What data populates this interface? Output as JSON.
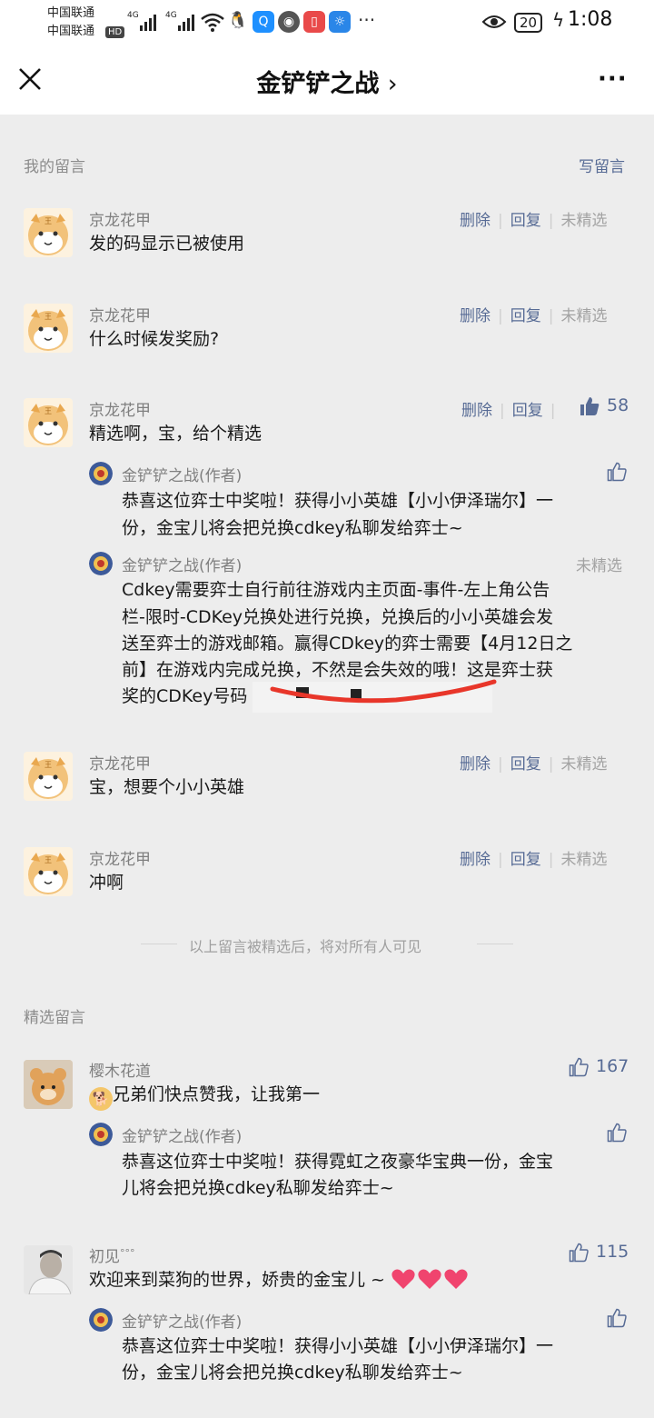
{
  "status_bar": {
    "carrier1": "中国联通",
    "carrier2": "中国联通",
    "hd": "HD",
    "net1": "4G",
    "net2": "4G",
    "battery": "20",
    "time": "1:08"
  },
  "header": {
    "title": "金铲铲之战",
    "title_chevron": "›"
  },
  "my_comments": {
    "label": "我的留言",
    "write_label": "写留言",
    "delete_label": "删除",
    "reply_label": "回复",
    "unselected_label": "未精选",
    "items": [
      {
        "author": "京龙花甲",
        "text": "发的码显示已被使用"
      },
      {
        "author": "京龙花甲",
        "text": "什么时候发奖励?"
      },
      {
        "author": "京龙花甲",
        "text": "精选啊，宝，给个精选",
        "likes": "58",
        "replies": [
          {
            "author": "金铲铲之战(作者)",
            "lines": [
              "恭喜这位弈士中奖啦！获得小小英雄【小小伊泽瑞尔】一",
              "份，金宝儿将会把兑换cdkey私聊发给弈士~"
            ]
          },
          {
            "author": "金铲铲之战(作者)",
            "status": "未精选",
            "lines": [
              "Cdkey需要弈士自行前往游戏内主页面-事件-左上角公告",
              "栏-限时-CDKey兑换处进行兑换，兑换后的小小英雄会发",
              "送至弈士的游戏邮箱。赢得CDkey的弈士需要【4月12日之",
              "前】在游戏内完成兑换，不然是会失效的哦！这是弈士获",
              "奖的CDKey号码"
            ]
          }
        ]
      },
      {
        "author": "京龙花甲",
        "text": "宝，想要个小小英雄"
      },
      {
        "author": "京龙花甲",
        "text": "冲啊"
      }
    ]
  },
  "notice": "以上留言被精选后，将对所有人可见",
  "featured": {
    "label": "精选留言",
    "items": [
      {
        "author": "樱木花道",
        "text": "兄弟们快点赞我，让我第一",
        "likes": "167",
        "replies": [
          {
            "author": "金铲铲之战(作者)",
            "lines": [
              "恭喜这位弈士中奖啦！获得霓虹之夜豪华宝典一份，金宝",
              "儿将会把兑换cdkey私聊发给弈士~"
            ]
          }
        ]
      },
      {
        "author": "初见",
        "author_suffix": "°°°",
        "text": "欢迎来到菜狗的世界，娇贵的金宝儿 ~",
        "likes": "115",
        "replies": [
          {
            "author": "金铲铲之战(作者)",
            "lines": [
              "恭喜这位弈士中奖啦！获得小小英雄【小小伊泽瑞尔】一",
              "份，金宝儿将会把兑换cdkey私聊发给弈士~"
            ]
          }
        ]
      }
    ]
  },
  "colors": {
    "link": "#576b95",
    "background": "#ededed",
    "heart": "#f0446e"
  }
}
